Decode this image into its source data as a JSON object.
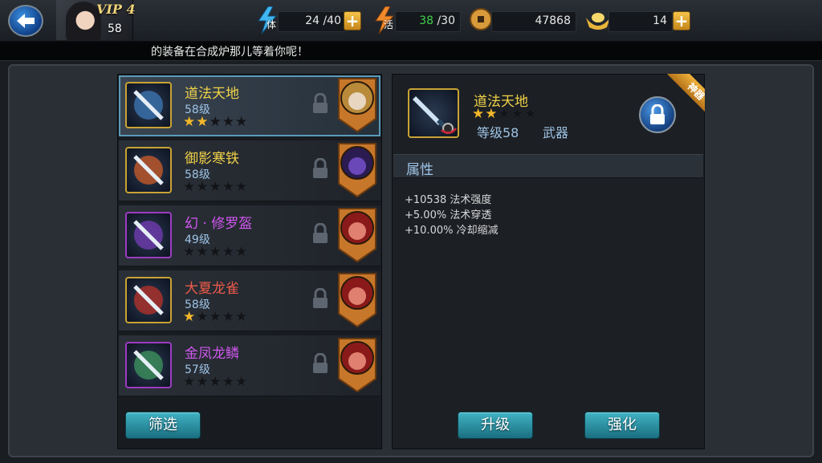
{
  "header": {
    "vip": "VIP 4",
    "player_level": "58",
    "stamina": {
      "tag": "体",
      "value": "24 /40"
    },
    "vigor": {
      "tag": "活",
      "current": "38",
      "max": "/30"
    },
    "coins": "47868",
    "gold_ingots": "14"
  },
  "ticker": "的装备在合成炉那儿等着你呢！",
  "equipment_list": [
    {
      "name": "道法天地",
      "level": "58级",
      "stars": 2,
      "rarity": "yellow",
      "selected": true,
      "hero": "blonde-hero-portrait"
    },
    {
      "name": "御影寒铁",
      "level": "58级",
      "stars": 0,
      "rarity": "yellow",
      "selected": false,
      "hero": "purple-hero-portrait"
    },
    {
      "name": "幻 · 修罗盔",
      "level": "49级",
      "stars": 0,
      "rarity": "purple",
      "selected": false,
      "hero": "red-hat-hero-portrait"
    },
    {
      "name": "大夏龙雀",
      "level": "58级",
      "stars": 1,
      "rarity": "red",
      "selected": false,
      "hero": "red-hat-hero-portrait"
    },
    {
      "name": "金凤龙鳞",
      "level": "57级",
      "stars": 0,
      "rarity": "purple",
      "selected": false,
      "hero": "red-hat-hero-portrait"
    }
  ],
  "buttons": {
    "filter": "筛选",
    "upgrade": "升级",
    "enhance": "强化"
  },
  "detail": {
    "name": "道法天地",
    "stars": 2,
    "level": "等级58",
    "type": "武器",
    "ribbon": "神器",
    "attributes_title": "属性",
    "attributes": [
      "+10538 法术强度",
      "+5.00% 法术穿透",
      "+10.00% 冷却缩减"
    ]
  },
  "colors": {
    "yellow": "#f0d248",
    "purple": "#cf58ee",
    "red": "#ee5a4a",
    "star": "#f3b72a",
    "button": "#2a95a6"
  }
}
